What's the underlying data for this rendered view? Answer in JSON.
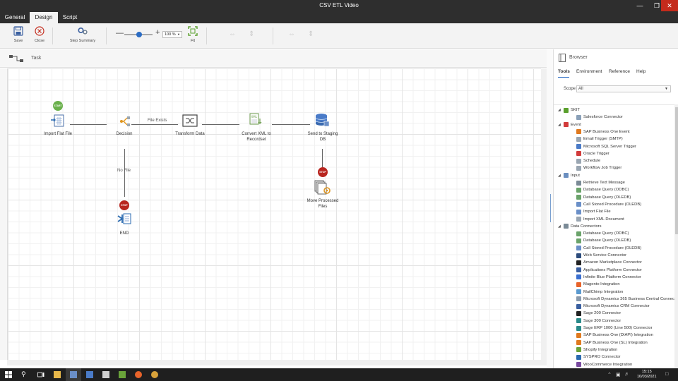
{
  "window": {
    "title": "CSV ETL Video"
  },
  "tabs": [
    {
      "label": "General"
    },
    {
      "label": "Design"
    },
    {
      "label": "Script"
    }
  ],
  "ribbon": {
    "save_label": "Save",
    "close_label": "Close",
    "step_summary_label": "Step Summary",
    "zoom_value": "100 %",
    "fit_label": "Fit",
    "zoom_level_percent": 100
  },
  "task_header": {
    "label": "Task"
  },
  "workflow": {
    "start_badge": "START",
    "stop_badge": "STOP",
    "nodes": {
      "import": "Import Flat File",
      "decision": "Decision",
      "transform": "Transform Data",
      "convert": "Convert XML to Recordset",
      "send": "Send to Staging DB",
      "move": "Move Processed Files",
      "end": "END"
    },
    "connectors": {
      "file_exists": "File Exists",
      "no_file": "No File"
    }
  },
  "browser": {
    "title": "Browser",
    "tabs": [
      {
        "label": "Tools"
      },
      {
        "label": "Environment"
      },
      {
        "label": "Reference"
      },
      {
        "label": "Help"
      }
    ],
    "scope_label": "Scope",
    "scope_value": "All",
    "tree": [
      {
        "label": "SKIT",
        "level": 0,
        "icon_color": "#5aa02c"
      },
      {
        "label": "Salesforce Connector",
        "level": 1,
        "icon_color": "#8aa0b8"
      },
      {
        "label": "Event",
        "level": 0,
        "icon_color": "#d23b3b"
      },
      {
        "label": "SAP Business One Event",
        "level": 1,
        "icon_color": "#e07a1f"
      },
      {
        "label": "Email Trigger (SMTP)",
        "level": 1,
        "icon_color": "#9aa6b2"
      },
      {
        "label": "Microsoft SQL Server Trigger",
        "level": 1,
        "icon_color": "#4a7bc8"
      },
      {
        "label": "Oracle Trigger",
        "level": 1,
        "icon_color": "#d23b3b"
      },
      {
        "label": "Schedule",
        "level": 1,
        "icon_color": "#9aa6b2"
      },
      {
        "label": "Workflow Job Trigger",
        "level": 1,
        "icon_color": "#9aa6b2"
      },
      {
        "label": "Input",
        "level": 0,
        "icon_color": "#6b8fc0"
      },
      {
        "label": "Retrieve Text Message",
        "level": 1,
        "icon_color": "#7a8a96"
      },
      {
        "label": "Database Query (ODBC)",
        "level": 1,
        "icon_color": "#6aa36a"
      },
      {
        "label": "Database Query (OLEDB)",
        "level": 1,
        "icon_color": "#6aa36a"
      },
      {
        "label": "Call Stored Procedure (OLEDB)",
        "level": 1,
        "icon_color": "#6a8fc8"
      },
      {
        "label": "Import Flat File",
        "level": 1,
        "icon_color": "#6a8fc8"
      },
      {
        "label": "Import XML Document",
        "level": 1,
        "icon_color": "#9aa6b2"
      },
      {
        "label": "Data Connectors",
        "level": 0,
        "icon_color": "#7a8a96"
      },
      {
        "label": "Database Query (ODBC)",
        "level": 1,
        "icon_color": "#6aa36a"
      },
      {
        "label": "Database Query (OLEDB)",
        "level": 1,
        "icon_color": "#6aa36a"
      },
      {
        "label": "Call Stored Procedure (OLEDB)",
        "level": 1,
        "icon_color": "#6a8fc8"
      },
      {
        "label": "Web Service Connector",
        "level": 1,
        "icon_color": "#2c4c7c"
      },
      {
        "label": "Amazon Marketplace Connector",
        "level": 1,
        "icon_color": "#222222"
      },
      {
        "label": "Applications Platform Connector",
        "level": 1,
        "icon_color": "#3a5fa0"
      },
      {
        "label": "Infinite Blue Platform Connector",
        "level": 1,
        "icon_color": "#3a6fd0"
      },
      {
        "label": "Magento Integration",
        "level": 1,
        "icon_color": "#e8632a"
      },
      {
        "label": "MailChimp Integration",
        "level": 1,
        "icon_color": "#5a9ad0"
      },
      {
        "label": "Microsoft Dynamics 365 Business Central Connector",
        "level": 1,
        "icon_color": "#8a9aac"
      },
      {
        "label": "Microsoft Dynamics CRM Connector",
        "level": 1,
        "icon_color": "#3a5fa0"
      },
      {
        "label": "Sage 200 Connector",
        "level": 1,
        "icon_color": "#222222"
      },
      {
        "label": "Sage 300 Connector",
        "level": 1,
        "icon_color": "#2a8a8a"
      },
      {
        "label": "Sage ERP 1000 (Line 500) Connector",
        "level": 1,
        "icon_color": "#2a8a8a"
      },
      {
        "label": "SAP Business One (DIAPI) Integration",
        "level": 1,
        "icon_color": "#e07a1f"
      },
      {
        "label": "SAP Business One (SL) Integration",
        "level": 1,
        "icon_color": "#e07a1f"
      },
      {
        "label": "Shopify Integration",
        "level": 1,
        "icon_color": "#6aa33a"
      },
      {
        "label": "SYSPRO Connector",
        "level": 1,
        "icon_color": "#2a6ab0"
      },
      {
        "label": "WooCommerce Integration",
        "level": 1,
        "icon_color": "#7a4aa0"
      }
    ]
  },
  "taskbar": {
    "time": "15:15",
    "date": "10/03/2021"
  }
}
